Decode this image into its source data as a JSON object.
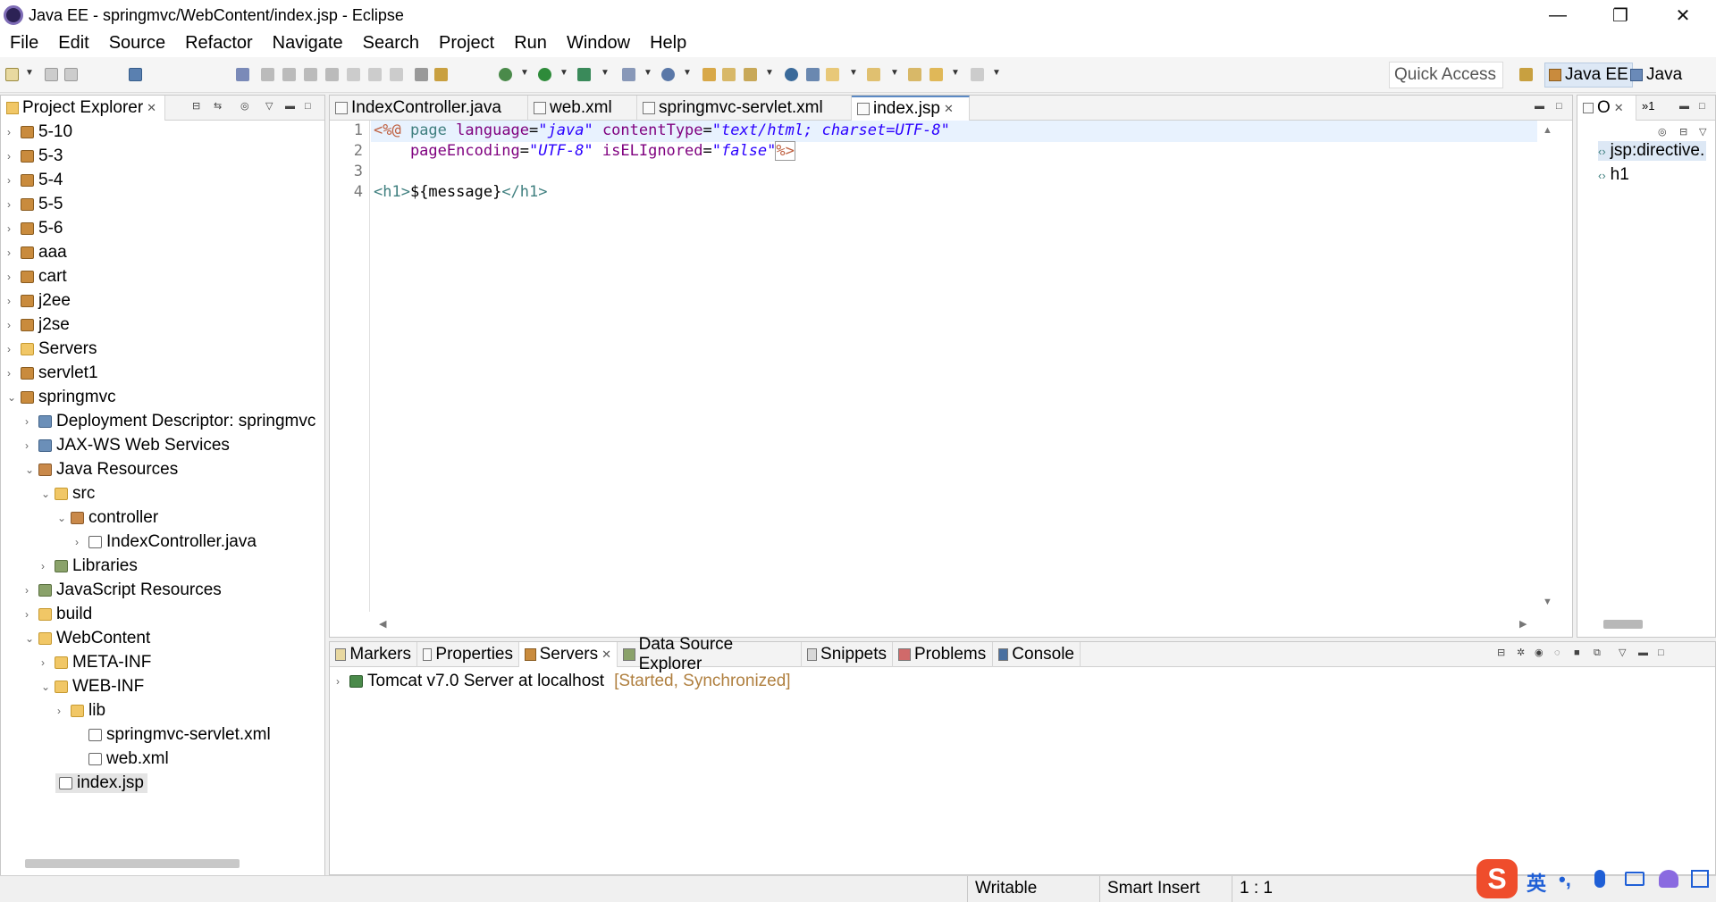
{
  "window": {
    "title": "Java EE - springmvc/WebContent/index.jsp - Eclipse",
    "minimize": "—",
    "maximize": "❐",
    "close": "✕"
  },
  "menu": [
    "File",
    "Edit",
    "Source",
    "Refactor",
    "Navigate",
    "Search",
    "Project",
    "Run",
    "Window",
    "Help"
  ],
  "toolbar": {
    "quick_access": "Quick Access",
    "perspectives": [
      {
        "label": "Java EE",
        "active": true
      },
      {
        "label": "Java",
        "active": false
      }
    ]
  },
  "project_explorer": {
    "tab_label": "Project Explorer",
    "tab_close": "✕",
    "items": [
      {
        "label": "5-10",
        "expanded": false
      },
      {
        "label": "5-3",
        "expanded": false
      },
      {
        "label": "5-4",
        "expanded": false
      },
      {
        "label": "5-5",
        "expanded": false
      },
      {
        "label": "5-6",
        "expanded": false
      },
      {
        "label": "aaa",
        "expanded": false
      },
      {
        "label": "cart",
        "expanded": false
      },
      {
        "label": "j2ee",
        "expanded": false
      },
      {
        "label": "j2se",
        "expanded": false
      },
      {
        "label": "Servers",
        "expanded": false
      },
      {
        "label": "servlet1",
        "expanded": false
      },
      {
        "label": "springmvc",
        "expanded": true
      },
      {
        "label": "Deployment Descriptor: springmvc",
        "expanded": false
      },
      {
        "label": "JAX-WS Web Services",
        "expanded": false
      },
      {
        "label": "Java Resources",
        "expanded": true
      },
      {
        "label": "src",
        "expanded": true
      },
      {
        "label": "controller",
        "expanded": true
      },
      {
        "label": "IndexController.java",
        "expanded": false
      },
      {
        "label": "Libraries",
        "expanded": false
      },
      {
        "label": "JavaScript Resources",
        "expanded": false
      },
      {
        "label": "build",
        "expanded": false
      },
      {
        "label": "WebContent",
        "expanded": true
      },
      {
        "label": "META-INF",
        "expanded": false
      },
      {
        "label": "WEB-INF",
        "expanded": true
      },
      {
        "label": "lib",
        "expanded": false
      },
      {
        "label": "springmvc-servlet.xml",
        "expanded": false
      },
      {
        "label": "web.xml",
        "expanded": false
      },
      {
        "label": "index.jsp",
        "expanded": false,
        "selected": true
      }
    ]
  },
  "editor": {
    "tabs": [
      {
        "label": "IndexController.java",
        "active": false
      },
      {
        "label": "web.xml",
        "active": false
      },
      {
        "label": "springmvc-servlet.xml",
        "active": false
      },
      {
        "label": "index.jsp",
        "active": true
      }
    ],
    "line_numbers": [
      "1",
      "2",
      "3",
      "4"
    ],
    "code": {
      "l1_open": "<%@",
      "l1_page": " page ",
      "l1_lang_attr": "language",
      "l1_eq": "=",
      "l1_lang_val": "\"java\"",
      "l1_ct_attr": " contentType",
      "l1_ct_val": "\"text/html; charset=UTF-8\"",
      "l2_pe_attr": "    pageEncoding",
      "l2_pe_val": "\"UTF-8\"",
      "l2_el_attr": " isELIgnored",
      "l2_el_val": "\"false\"",
      "l2_close": "%>",
      "l4_open": "<h1>",
      "l4_expr": "${message}",
      "l4_close": "</h1>"
    }
  },
  "outline": {
    "tab_label": "O",
    "tab_close": "✕",
    "overflow": "»1",
    "items": [
      "jsp:directive.",
      "h1"
    ]
  },
  "bottom_panel": {
    "tabs": [
      "Markers",
      "Properties",
      "Servers",
      "Data Source Explorer",
      "Snippets",
      "Problems",
      "Console"
    ],
    "active_tab": "Servers",
    "server_name": "Tomcat v7.0 Server at localhost",
    "server_state": "[Started, Synchronized]"
  },
  "statusbar": {
    "writable": "Writable",
    "insert_mode": "Smart Insert",
    "position": "1 : 1"
  },
  "ime": {
    "logo": "S",
    "lang": "英"
  },
  "colors": {
    "keyword": "#3f7f7f",
    "attribute": "#7f007f",
    "value": "#2a00ff",
    "server_state": "#b08040",
    "active_tab_border": "#5c8ac4"
  }
}
